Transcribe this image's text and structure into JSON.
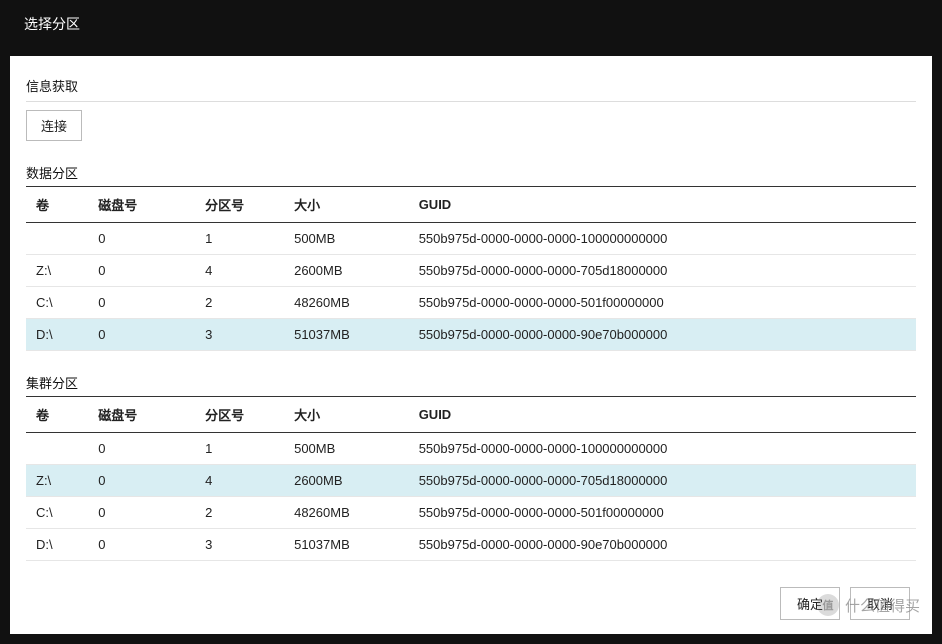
{
  "modal": {
    "title": "选择分区"
  },
  "info_section": {
    "label": "信息获取",
    "connect_label": "连接"
  },
  "columns": {
    "volume": "卷",
    "disk_no": "磁盘号",
    "part_no": "分区号",
    "size": "大小",
    "guid": "GUID"
  },
  "data_section": {
    "title": "数据分区",
    "selected_index": 3,
    "rows": [
      {
        "volume": "",
        "disk": "0",
        "part": "1",
        "size": "500MB",
        "guid": "550b975d-0000-0000-0000-100000000000"
      },
      {
        "volume": "Z:\\",
        "disk": "0",
        "part": "4",
        "size": "2600MB",
        "guid": "550b975d-0000-0000-0000-705d18000000"
      },
      {
        "volume": "C:\\",
        "disk": "0",
        "part": "2",
        "size": "48260MB",
        "guid": "550b975d-0000-0000-0000-501f00000000"
      },
      {
        "volume": "D:\\",
        "disk": "0",
        "part": "3",
        "size": "51037MB",
        "guid": "550b975d-0000-0000-0000-90e70b000000"
      }
    ]
  },
  "cluster_section": {
    "title": "集群分区",
    "selected_index": 1,
    "rows": [
      {
        "volume": "",
        "disk": "0",
        "part": "1",
        "size": "500MB",
        "guid": "550b975d-0000-0000-0000-100000000000"
      },
      {
        "volume": "Z:\\",
        "disk": "0",
        "part": "4",
        "size": "2600MB",
        "guid": "550b975d-0000-0000-0000-705d18000000"
      },
      {
        "volume": "C:\\",
        "disk": "0",
        "part": "2",
        "size": "48260MB",
        "guid": "550b975d-0000-0000-0000-501f00000000"
      },
      {
        "volume": "D:\\",
        "disk": "0",
        "part": "3",
        "size": "51037MB",
        "guid": "550b975d-0000-0000-0000-90e70b000000"
      }
    ]
  },
  "footer": {
    "ok": "确定",
    "cancel": "取消"
  },
  "watermark": {
    "text": "什么值得买"
  }
}
